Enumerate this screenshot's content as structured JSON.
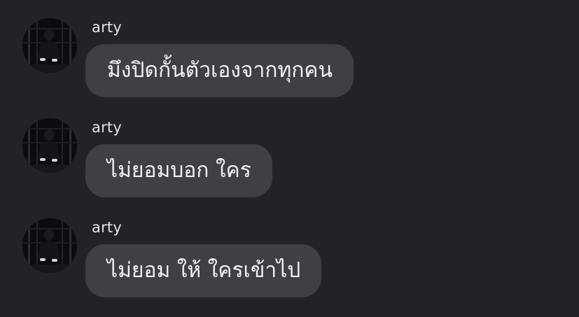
{
  "colors": {
    "background": "#222328",
    "bubble": "#3f4046",
    "bubble_text": "#f2f2f4",
    "sender_text": "#e4e4e6"
  },
  "messages": [
    {
      "sender": "arty",
      "avatar_icon": "profile-photo",
      "text": "มึงปิดกั้นตัวเองจากทุกคน"
    },
    {
      "sender": "arty",
      "avatar_icon": "profile-photo",
      "text": "ไม่ยอมบอก ใคร"
    },
    {
      "sender": "arty",
      "avatar_icon": "profile-photo",
      "text": "ไม่ยอม ให้ ใครเข้าไป"
    }
  ]
}
